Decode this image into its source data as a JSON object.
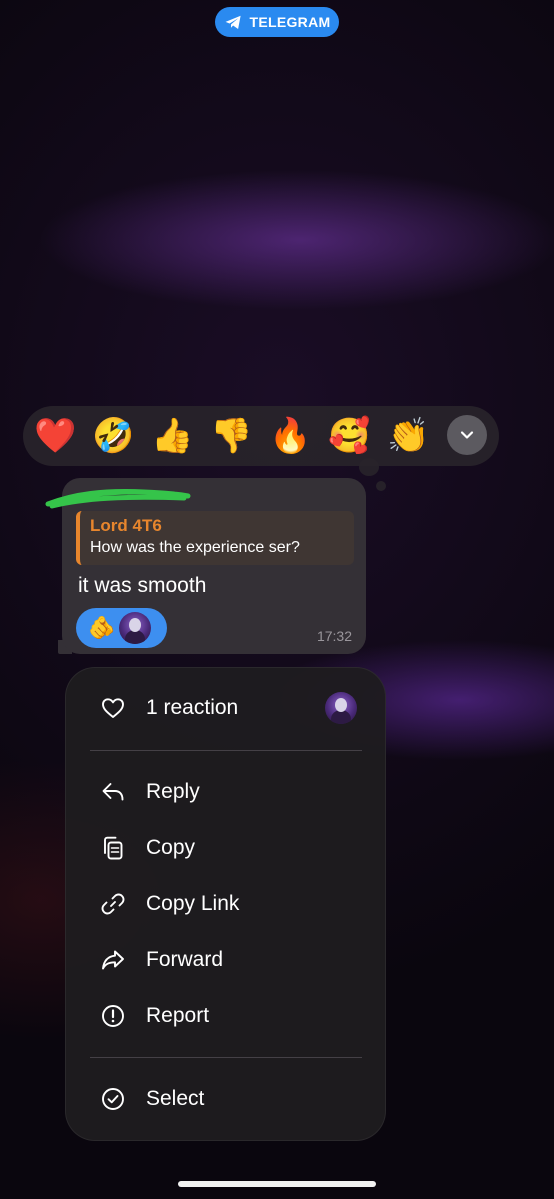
{
  "banner": {
    "app_name": "TELEGRAM"
  },
  "reactions": {
    "emojis": [
      "❤️",
      "🤣",
      "👍",
      "👎",
      "🔥",
      "🥰",
      "👏"
    ]
  },
  "message": {
    "reply_to_name": "Lord 4T6",
    "reply_to_text": "How was the experience ser?",
    "text": "it was smooth",
    "reaction_emoji": "🫵",
    "time": "17:32"
  },
  "menu": {
    "reactions_label": "1 reaction",
    "items": [
      {
        "label": "Reply",
        "icon": "reply-icon"
      },
      {
        "label": "Copy",
        "icon": "copy-icon"
      },
      {
        "label": "Copy Link",
        "icon": "link-icon"
      },
      {
        "label": "Forward",
        "icon": "forward-icon"
      },
      {
        "label": "Report",
        "icon": "report-icon"
      }
    ],
    "select_label": "Select"
  },
  "colors": {
    "accent": "#2a8af0",
    "reply_name": "#e8862d",
    "reaction_chip": "#3d8ff0"
  }
}
